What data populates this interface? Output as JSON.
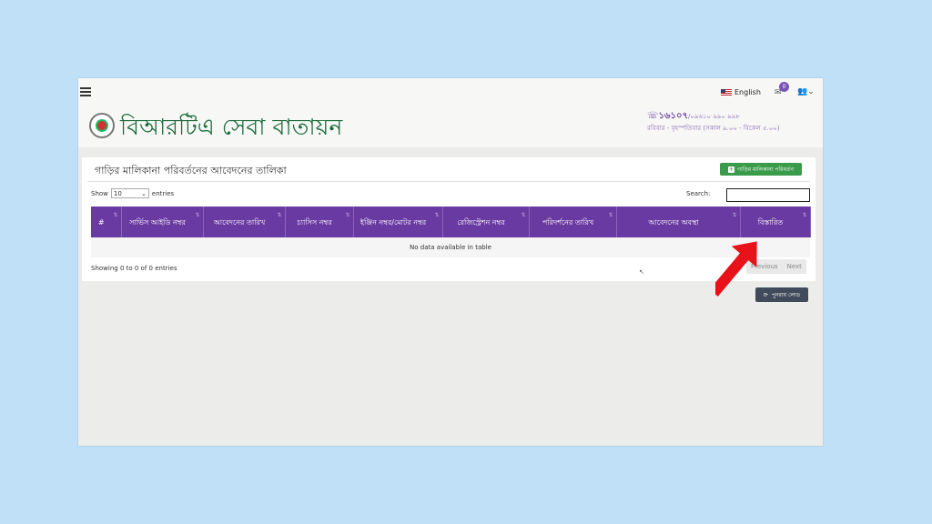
{
  "header": {
    "language": "English",
    "mail_count": "0",
    "brand": "বিআরটিএ সেবা বাতায়ন",
    "hotline": "☏১৬১০৭",
    "hotline_alt": "/০৯৬১০ ৯৯০ ৯৯৮",
    "hours": "রবিবার - বৃহস্পতিবার (সকাল ৯.০০ - বিকেল ৫.০০)"
  },
  "card": {
    "title": "গাড়ির মালিকানা পরিবর্তনের আবেদনের তালিকা",
    "change_button": "গাড়ির মালিকানা পরিবর্তন",
    "show_label": "Show",
    "length_value": "10",
    "entries_label": "entries",
    "search_label": "Search:",
    "columns": [
      "#",
      "সার্ভিস আইডি নম্বর",
      "আবেদনের তারিখ",
      "চ্যাসিস নম্বর",
      "ইঞ্জিন নম্বর/মোটর নম্বর",
      "রেজিস্ট্রেশন নম্বর",
      "পরিদর্শনের তারিখ",
      "আবেদনের অবস্থা",
      "বিস্তারিত"
    ],
    "empty_message": "No data available in table",
    "info": "Showing 0 to 0 of 0 entries",
    "previous": "Previous",
    "next": "Next"
  },
  "refresh_button": "পুনরায় লোড",
  "colors": {
    "header_purple": "#6a3aa3",
    "brand_green": "#1d6b3c",
    "button_green": "#3a9b4a",
    "arrow_red": "#e8121a"
  },
  "icons": [
    "hamburger-icon",
    "mail-icon",
    "user-icon",
    "plus-icon",
    "refresh-icon",
    "arrow-pointer"
  ]
}
